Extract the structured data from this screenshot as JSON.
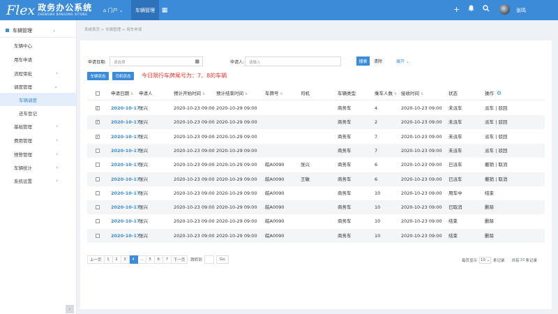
{
  "app": {
    "logo_mark": "Flex",
    "logo_main": "政务办公系统",
    "logo_sub": "ZHENGWU BANGONG XITONG",
    "nav": {
      "portal": "门户",
      "car_mgmt": "车辆管理",
      "grid_icon": "grid-icon"
    },
    "user_name": "张鸣",
    "accent_color": "#3c8bd9"
  },
  "sidebar": {
    "title": "车辆管理",
    "items": [
      {
        "label": "车辆中心",
        "arrow": ""
      },
      {
        "label": "用车申请",
        "arrow": ""
      },
      {
        "label": "流程审批",
        "arrow": "›"
      },
      {
        "label": "调度管理",
        "arrow": "⌄"
      },
      {
        "label": "车辆调度",
        "arrow": "",
        "sub": true,
        "active": true
      },
      {
        "label": "还车登记",
        "arrow": "",
        "sub": true
      },
      {
        "label": "基础管理",
        "arrow": "›"
      },
      {
        "label": "费用管理",
        "arrow": "›"
      },
      {
        "label": "预警管理",
        "arrow": "›"
      },
      {
        "label": "车辆统计",
        "arrow": "›"
      },
      {
        "label": "系统设置",
        "arrow": "›"
      }
    ],
    "collapse": "‹"
  },
  "breadcrumb": "系统首页 > 车辆管理 > 用车申请",
  "filters": {
    "date_label": "申请日期:",
    "date_placeholder": "请选择",
    "applicant_label": "申请人:",
    "applicant_placeholder": "请输入",
    "search_btn": "搜索",
    "clear_btn": "清除",
    "expand_btn": "展开 ⌄"
  },
  "actions": {
    "car_status": "车辆状态",
    "driver_status": "司机状态"
  },
  "notice": "今日限行车牌尾号为：7、8的车辆",
  "table": {
    "headers": [
      "申请日期",
      "申请人",
      "预计开始时间",
      "预计结束时间",
      "车牌号",
      "司机",
      "车辆类型",
      "乘车人数",
      "接收时间",
      "状态",
      "操作"
    ],
    "rows": [
      {
        "checked": true,
        "date": "2020-10-17",
        "applicant": "张兴",
        "start": "2020-10-23 09:00",
        "end": "2020-10-29 09:00",
        "plate": "",
        "driver": "",
        "type": "商务车",
        "count": "4",
        "received": "2020-10-23 09:00",
        "status": "未派车",
        "op": "派车 | 驳回"
      },
      {
        "checked": true,
        "date": "2020-10-17",
        "applicant": "张兴",
        "start": "2020-10-23 09:00",
        "end": "2020-10-29 09:00",
        "plate": "",
        "driver": "",
        "type": "商务车",
        "count": "2",
        "received": "2020-10-23 09:00",
        "status": "未派车",
        "op": "派车 | 驳回"
      },
      {
        "checked": true,
        "date": "2020-10-17",
        "applicant": "张兴",
        "start": "2020-10-23 09:00",
        "end": "2020-10-29 09:00",
        "plate": "",
        "driver": "",
        "type": "商务车",
        "count": "7",
        "received": "2020-10-23 09:00",
        "status": "未派车",
        "op": "派车 | 驳回"
      },
      {
        "checked": false,
        "date": "2020-10-17",
        "applicant": "张兴",
        "start": "2020-10-23 09:00",
        "end": "2020-10-29 09:00",
        "plate": "",
        "driver": "",
        "type": "商务车",
        "count": "7",
        "received": "2020-10-23 09:00",
        "status": "未派车",
        "op": "派车 | 驳回"
      },
      {
        "checked": false,
        "date": "2020-10-17",
        "applicant": "张兴",
        "start": "2020-10-23 09:00",
        "end": "2020-10-29 09:00",
        "plate": "皖A0090",
        "driver": "张兴",
        "type": "商务车",
        "count": "6",
        "received": "2020-10-23 09:00",
        "status": "已派车",
        "op": "撤销 | 取消"
      },
      {
        "checked": false,
        "date": "2020-10-17",
        "applicant": "张兴",
        "start": "2020-10-23 09:00",
        "end": "2020-10-29 09:00",
        "plate": "皖A0090",
        "driver": "王敏",
        "type": "商务车",
        "count": "6",
        "received": "2020-10-23 09:00",
        "status": "已派车",
        "op": "撤销 | 取消"
      },
      {
        "checked": false,
        "date": "2020-10-17",
        "applicant": "张兴",
        "start": "2020-10-23 09:00",
        "end": "2020-10-29 09:00",
        "plate": "皖A0090",
        "driver": "",
        "type": "商务车",
        "count": "10",
        "received": "2020-10-23 09:00",
        "status": "用车中",
        "op": "结束"
      },
      {
        "checked": false,
        "date": "2020-10-17",
        "applicant": "张兴",
        "start": "2020-10-23 09:00",
        "end": "2020-10-29 09:00",
        "plate": "皖A0090",
        "driver": "",
        "type": "商务车",
        "count": "10",
        "received": "2020-10-23 09:00",
        "status": "已取消",
        "op": "删除"
      },
      {
        "checked": false,
        "date": "2020-10-17",
        "applicant": "张兴",
        "start": "2020-10-23 09:00",
        "end": "2020-10-29 09:00",
        "plate": "皖A0090",
        "driver": "",
        "type": "商务车",
        "count": "10",
        "received": "2020-10-23 09:00",
        "status": "结束",
        "op": "删除"
      },
      {
        "checked": false,
        "date": "2020-10-17",
        "applicant": "张兴",
        "start": "2020-10-23 09:00",
        "end": "2020-10-29 09:00",
        "plate": "皖A0090",
        "driver": "",
        "type": "商务车",
        "count": "10",
        "received": "2020-10-23 09:00",
        "status": "结束",
        "op": "删除"
      }
    ]
  },
  "pagination": {
    "prev": "上一页",
    "pages": [
      "1",
      "2",
      "3",
      "4",
      "...",
      "5",
      "6",
      "7"
    ],
    "active_page": "4",
    "next": "下一页",
    "goto_label": "跳转到",
    "goto_btn": "Go",
    "per_page_prefix": "每页显示",
    "per_page_value": "10",
    "per_page_suffix": "条记录",
    "total_prefix": "共有",
    "total_value": "10",
    "total_suffix": "条记录"
  }
}
